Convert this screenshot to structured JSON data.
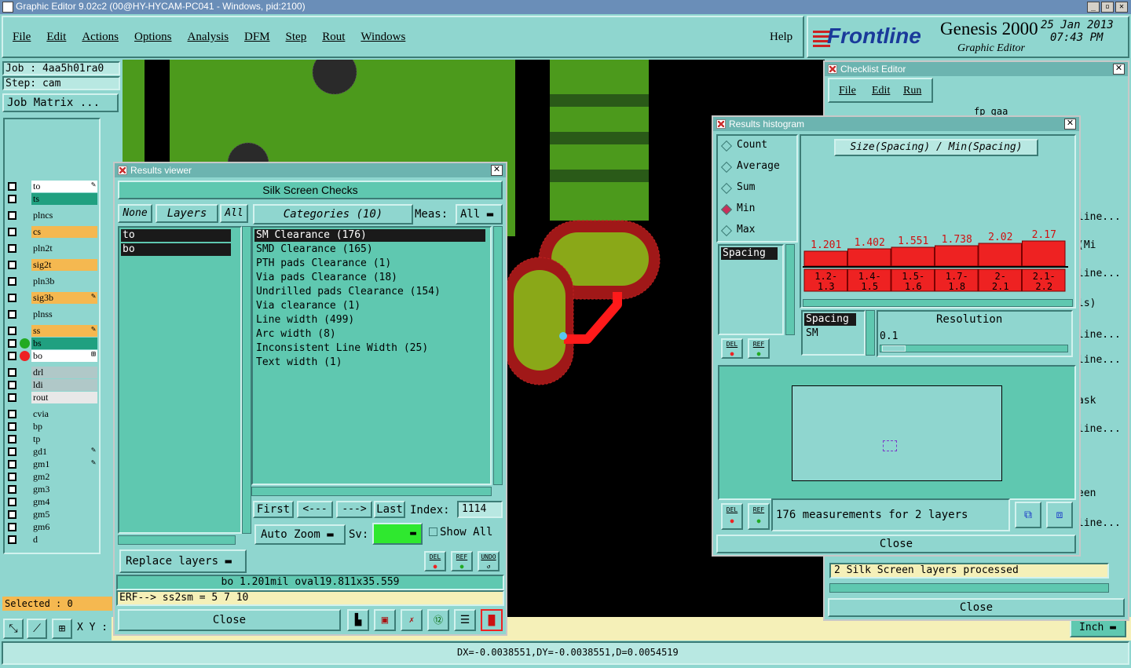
{
  "app_title": "Graphic Editor 9.02c2 (00@HY-HYCAM-PC041 - Windows, pid:2100)",
  "menu": [
    "File",
    "Edit",
    "Actions",
    "Options",
    "Analysis",
    "DFM",
    "Step",
    "Rout",
    "Windows"
  ],
  "help_label": "Help",
  "brand": {
    "logo": "Frontline",
    "product": "Genesis 2000",
    "subtitle": "Graphic Editor",
    "date": "25 Jan 2013",
    "time": "07:43 PM"
  },
  "job": {
    "job_label": "Job : 4aa5h01ra0",
    "step_label": "Step: cam",
    "matrix_button": "Job Matrix ..."
  },
  "layers": [
    {
      "name": "to",
      "color": "#ffffff",
      "mark": "✎"
    },
    {
      "name": "ts",
      "color": "#20a080"
    },
    {
      "name": "plncs",
      "color": "#8fd6cf"
    },
    {
      "name": "cs",
      "color": "#f5b850"
    },
    {
      "name": "pln2t",
      "color": "#8fd6cf"
    },
    {
      "name": "sig2t",
      "color": "#f5b850"
    },
    {
      "name": "pln3b",
      "color": "#8fd6cf"
    },
    {
      "name": "sig3b",
      "color": "#f5b850",
      "mark": "✎"
    },
    {
      "name": "plnss",
      "color": "#8fd6cf"
    },
    {
      "name": "ss",
      "color": "#f5b850",
      "mark": "✎"
    },
    {
      "name": "bs",
      "color": "#20a080",
      "dot": "#22aa22"
    },
    {
      "name": "bo",
      "color": "#ffffff",
      "dot": "#ee2222",
      "mark": "⊞"
    },
    {
      "name": "drl",
      "color": "#b0c8c8"
    },
    {
      "name": "ldi",
      "color": "#b0c8c8"
    },
    {
      "name": "rout",
      "color": "#e8e8e8"
    },
    {
      "name": "cvia",
      "color": "#8fd6cf"
    },
    {
      "name": "bp",
      "color": "#8fd6cf"
    },
    {
      "name": "tp",
      "color": "#8fd6cf"
    },
    {
      "name": "gd1",
      "color": "#8fd6cf",
      "mark": "✎"
    },
    {
      "name": "gm1",
      "color": "#8fd6cf",
      "mark": "✎"
    },
    {
      "name": "gm2",
      "color": "#8fd6cf"
    },
    {
      "name": "gm3",
      "color": "#8fd6cf"
    },
    {
      "name": "gm4",
      "color": "#8fd6cf"
    },
    {
      "name": "gm5",
      "color": "#8fd6cf"
    },
    {
      "name": "gm6",
      "color": "#8fd6cf"
    },
    {
      "name": "d",
      "color": "#8fd6cf"
    }
  ],
  "selected_label": "Selected : 0",
  "xy_label": "X Y :",
  "status_bar": "DX=-0.0038551,DY=-0.0038551,D=0.0054519",
  "units_label": "Inch",
  "results_viewer": {
    "title": "Results viewer",
    "header": "Silk Screen Checks",
    "none_label": "None",
    "layers_label": "Layers",
    "all_label": "All",
    "categories_label": "Categories (10)",
    "meas_label": "Meas:",
    "meas_value": "All",
    "layer_list": [
      "to",
      "bo"
    ],
    "categories": [
      "SM Clearance (176)",
      "SMD Clearance (165)",
      "PTH pads Clearance (1)",
      "Via pads Clearance (18)",
      "Undrilled pads Clearance (154)",
      "Via clearance (1)",
      "Line width (499)",
      "Arc width (8)",
      "Inconsistent Line Width (25)",
      "Text width (1)"
    ],
    "first_label": "First",
    "prev_label": "<---",
    "next_label": "--->",
    "last_label": "Last",
    "index_label": "Index:",
    "index_value": "1114",
    "auto_zoom_label": "Auto Zoom",
    "sv_label": "Sv:",
    "show_all_label": "Show All",
    "replace_layers_label": "Replace layers",
    "del_label": "DEL",
    "ref_label": "REF",
    "undo_label": "UNDO",
    "info_line": "bo 1.201mil   oval19.811x35.559",
    "erf_line": "ERF--> ss2sm = 5 7 10",
    "close_label": "Close"
  },
  "histogram": {
    "title": "Results histogram",
    "options": [
      "Count",
      "Average",
      "Sum",
      "Min",
      "Max"
    ],
    "selected_option": "Min",
    "chart_title": "Size(Spacing) / Min(Spacing)",
    "type_list": [
      "Spacing"
    ],
    "del_label": "DEL",
    "ref_label": "REF",
    "layers_list": [
      "Spacing",
      "SM"
    ],
    "resolution_label": "Resolution",
    "resolution_value": "0.1",
    "summary": "176 measurements for 2 layers",
    "close_label": "Close"
  },
  "chart_data": {
    "type": "bar",
    "title": "Size(Spacing) / Min(Spacing)",
    "categories": [
      "1.2-1.3",
      "1.4-1.5",
      "1.5-1.6",
      "1.7-1.8",
      "2-2.1",
      "2.1-2.2"
    ],
    "values": [
      1.201,
      1.402,
      1.551,
      1.738,
      2.02,
      2.17
    ],
    "value_labels": [
      "1.201",
      "1.402",
      "1.551",
      "1.738",
      "2.02",
      "2.17"
    ],
    "bar_heights": [
      0.45,
      0.55,
      0.6,
      0.68,
      0.8,
      0.9
    ],
    "bar_color": "#ee2222"
  },
  "checklist": {
    "title": "Checklist Editor",
    "menu": [
      "File",
      "Edit",
      "Run"
    ],
    "row_fragments": [
      "fp_gaa",
      "line...",
      "(Mi",
      "line...",
      "ls)",
      "line...",
      "line...",
      "ask",
      "line...",
      "een",
      "line..."
    ],
    "status": "2 Silk Screen layers processed",
    "close_label": "Close"
  },
  "colors": {
    "panel": "#8fd6cf",
    "teal": "#5fc8b0",
    "accent_red": "#ee2222",
    "board_green": "#4c9a1c",
    "selected_dark": "#1a1a1a"
  }
}
